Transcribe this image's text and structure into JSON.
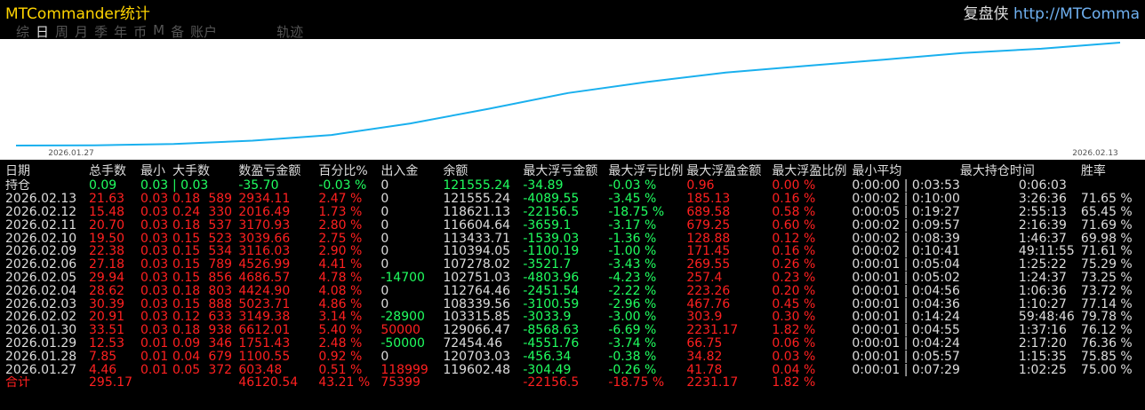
{
  "app": {
    "title": "MTCommander统计",
    "brand": "复盘侠 http://MTComma"
  },
  "tabs": [
    "综",
    "日",
    "周",
    "月",
    "季",
    "年",
    "币",
    "M",
    "备",
    "账户",
    "轨迹"
  ],
  "active_tab": 1,
  "colors": {
    "red": "#ff2020",
    "green": "#20ff60",
    "line": "#1ab0ee",
    "title": "#ffd400"
  },
  "chart_data": {
    "type": "line",
    "x_ticks": [
      "2026.01.27",
      "2026.02.13"
    ],
    "values": [
      72454.46,
      72600,
      73200,
      74800,
      77500,
      83000,
      90000,
      97500,
      102751,
      107278,
      110394,
      113434,
      116604,
      118621,
      121555
    ]
  },
  "table": {
    "headers": [
      "日期",
      "总手数",
      "最小",
      "大手数",
      "数盈亏金额",
      "百分比%",
      "出入金",
      "余额",
      "最大浮亏金额",
      "最大浮亏比例",
      "最大浮盈金额",
      "最大浮盈比例",
      "最小平均",
      "最大持仓时间",
      "胜率"
    ],
    "rows": [
      [
        "持仓",
        "0.09",
        "0.03",
        "0.03",
        "-35.70",
        "-0.03 %",
        "0",
        "121555.24",
        "-34.89",
        "-0.03 %",
        "0.96",
        "0.00 %",
        "0:00:00",
        "0:03:53",
        "0:06:03",
        ""
      ],
      [
        "2026.02.13",
        "21.63",
        "0.03",
        "0.18",
        "589",
        "2934.11",
        "2.47 %",
        "0",
        "121555.24",
        "-4089.55",
        "-3.45 %",
        "185.13",
        "0.16 %",
        "0:00:02",
        "0:10:00",
        "3:26:36",
        "71.65 %"
      ],
      [
        "2026.02.12",
        "15.48",
        "0.03",
        "0.24",
        "330",
        "2016.49",
        "1.73 %",
        "0",
        "118621.13",
        "-22156.5",
        "-18.75 %",
        "689.58",
        "0.58 %",
        "0:00:05",
        "0:19:27",
        "2:55:13",
        "65.45 %"
      ],
      [
        "2026.02.11",
        "20.70",
        "0.03",
        "0.18",
        "537",
        "3170.93",
        "2.80 %",
        "0",
        "116604.64",
        "-3659.1",
        "-3.17 %",
        "679.25",
        "0.60 %",
        "0:00:02",
        "0:09:57",
        "2:16:39",
        "71.69 %"
      ],
      [
        "2026.02.10",
        "19.50",
        "0.03",
        "0.15",
        "523",
        "3039.66",
        "2.75 %",
        "0",
        "113433.71",
        "-1539.03",
        "-1.36 %",
        "128.88",
        "0.12 %",
        "0:00:02",
        "0:08:39",
        "1:46:37",
        "69.98 %"
      ],
      [
        "2026.02.09",
        "22.38",
        "0.03",
        "0.15",
        "534",
        "3116.03",
        "2.90 %",
        "0",
        "110394.05",
        "-1100.19",
        "-1.00 %",
        "171.45",
        "0.16 %",
        "0:00:02",
        "0:10:41",
        "49:11:55",
        "71.61 %"
      ],
      [
        "2026.02.06",
        "27.18",
        "0.03",
        "0.15",
        "789",
        "4526.99",
        "4.41 %",
        "0",
        "107278.02",
        "-3521.7",
        "-3.43 %",
        "269.55",
        "0.26 %",
        "0:00:01",
        "0:05:04",
        "1:25:22",
        "75.29 %"
      ],
      [
        "2026.02.05",
        "29.94",
        "0.03",
        "0.15",
        "856",
        "4686.57",
        "4.78 %",
        "-14700",
        "102751.03",
        "-4803.96",
        "-4.23 %",
        "257.4",
        "0.23 %",
        "0:00:01",
        "0:05:02",
        "1:24:37",
        "73.25 %"
      ],
      [
        "2026.02.04",
        "28.62",
        "0.03",
        "0.18",
        "803",
        "4424.90",
        "4.08 %",
        "0",
        "112764.46",
        "-2451.54",
        "-2.22 %",
        "223.26",
        "0.20 %",
        "0:00:01",
        "0:04:56",
        "1:06:36",
        "73.72 %"
      ],
      [
        "2026.02.03",
        "30.39",
        "0.03",
        "0.15",
        "888",
        "5023.71",
        "4.86 %",
        "0",
        "108339.56",
        "-3100.59",
        "-2.96 %",
        "467.76",
        "0.45 %",
        "0:00:01",
        "0:04:36",
        "1:10:27",
        "77.14 %"
      ],
      [
        "2026.02.02",
        "20.91",
        "0.03",
        "0.12",
        "633",
        "3149.38",
        "3.14 %",
        "-28900",
        "103315.85",
        "-3033.9",
        "-3.00 %",
        "303.9",
        "0.30 %",
        "0:00:01",
        "0:14:24",
        "59:48:46",
        "79.78 %"
      ],
      [
        "2026.01.30",
        "33.51",
        "0.03",
        "0.18",
        "938",
        "6612.01",
        "5.40 %",
        "50000",
        "129066.47",
        "-8568.63",
        "-6.69 %",
        "2231.17",
        "1.82 %",
        "0:00:01",
        "0:04:55",
        "1:37:16",
        "76.12 %"
      ],
      [
        "2026.01.29",
        "12.53",
        "0.01",
        "0.09",
        "346",
        "1751.43",
        "2.48 %",
        "-50000",
        "72454.46",
        "-4551.76",
        "-3.74 %",
        "66.75",
        "0.06 %",
        "0:00:01",
        "0:04:24",
        "2:17:20",
        "76.36 %"
      ],
      [
        "2026.01.28",
        "7.85",
        "0.01",
        "0.04",
        "679",
        "1100.55",
        "0.92 %",
        "0",
        "120703.03",
        "-456.34",
        "-0.38 %",
        "34.82",
        "0.03 %",
        "0:00:01",
        "0:05:57",
        "1:15:35",
        "75.85 %"
      ],
      [
        "2026.01.27",
        "4.46",
        "0.01",
        "0.05",
        "372",
        "603.48",
        "0.51 %",
        "118999",
        "119602.48",
        "-304.49",
        "-0.26 %",
        "41.78",
        "0.04 %",
        "0:00:01",
        "0:07:29",
        "1:02:25",
        "75.00 %"
      ]
    ],
    "total": [
      "合计",
      "295.17",
      "",
      "",
      "",
      "46120.54",
      "43.21 %",
      "75399",
      "",
      "-22156.5",
      "-18.75 %",
      "2231.17",
      "1.82 %",
      "",
      "",
      "",
      ""
    ]
  }
}
